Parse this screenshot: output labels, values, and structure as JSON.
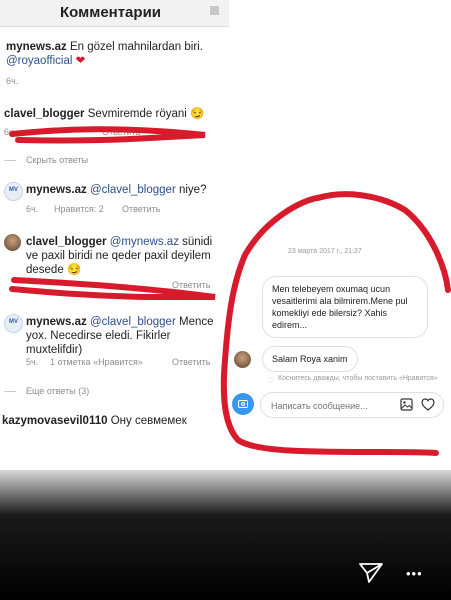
{
  "header": {
    "title": "Комментарии"
  },
  "comments": [
    {
      "user": "mynews.az",
      "text": "En gözel mahnilardan biri.",
      "mention": "@royaofficial",
      "emoji": "❤",
      "time": "6ч."
    },
    {
      "user": "clavel_blogger",
      "text": "Sevmiremde röyani",
      "emoji": "😏",
      "time": "6ч.",
      "reply": "Ответить"
    },
    {
      "hide_replies": "Скрыть ответы"
    },
    {
      "avatar": "MV",
      "user": "mynews.az",
      "mention": "@clavel_blogger",
      "text": "niye?",
      "time": "6ч.",
      "likes": "Нравится: 2",
      "reply": "Ответить"
    },
    {
      "user": "clavel_blogger",
      "mention": "@mynews.az",
      "text_line1": "sünidi",
      "text_line2": "ve paxil biridi ne qeder paxil deyilem",
      "text_line3": "desede",
      "emoji": "😏",
      "reply": "Ответить"
    },
    {
      "avatar": "MV",
      "user": "mynews.az",
      "mention": "@clavel_blogger",
      "text_line1": "Mence",
      "text_line2": "yox. Necedirse eledi. Fikirler",
      "text_line3": "muxtelifdir)",
      "time": "5ч.",
      "likes": "1 отметка «Нравится»",
      "reply": "Ответить"
    },
    {
      "more_replies": "Еще ответы (3)"
    },
    {
      "user": "kazymovasevil0110",
      "text": "Ону севмемек"
    }
  ],
  "dm": {
    "timestamp": "23 марта 2017 г., 21:37",
    "message": "Men telebeyem oxumaq ucun vesaitlerimi ala bilmirem.Mene pul komekliyi ede bilersiz? Xahis edirem...",
    "reply": "Salam Roya xanim",
    "hint": "Коснитесь дважды, чтобы поставить «Нравится»",
    "input_placeholder": "Написать сообщение..."
  },
  "story": {
    "send_icon": "send-icon",
    "more_icon": "more-icon",
    "more_label": "•••"
  },
  "colors": {
    "annotation": "#d81b2c",
    "link": "#2c4f8a",
    "dm_accent": "#3897f0"
  }
}
